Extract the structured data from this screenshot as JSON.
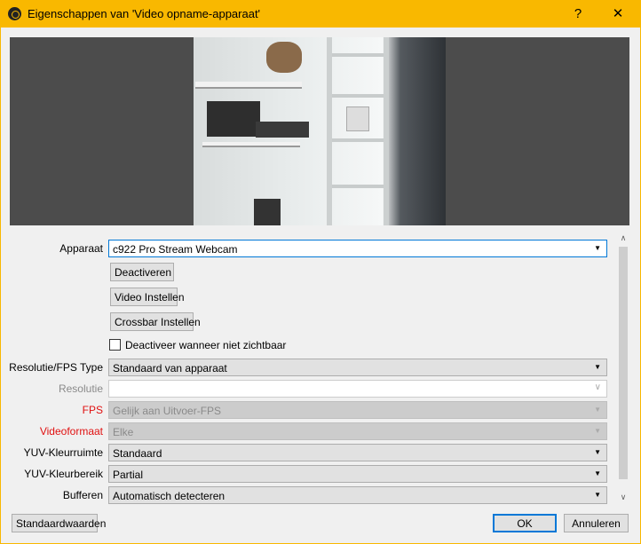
{
  "window": {
    "title": "Eigenschappen van 'Video opname-apparaat'",
    "help": "?",
    "close": "✕"
  },
  "form": {
    "device": {
      "label": "Apparaat",
      "value": "c922 Pro Stream Webcam"
    },
    "deactivate_button": "Deactiveren",
    "video_settings_button": "Video Instellen",
    "crossbar_button": "Crossbar Instellen",
    "deactivate_invisible": {
      "label": "Deactiveer wanneer niet zichtbaar",
      "checked": false
    },
    "res_fps_type": {
      "label": "Resolutie/FPS Type",
      "value": "Standaard van apparaat"
    },
    "resolution": {
      "label": "Resolutie",
      "value": ""
    },
    "fps": {
      "label": "FPS",
      "value": "Gelijk aan Uitvoer-FPS"
    },
    "video_format": {
      "label": "Videoformaat",
      "value": "Elke"
    },
    "yuv_colorspace": {
      "label": "YUV-Kleurruimte",
      "value": "Standaard"
    },
    "yuv_range": {
      "label": "YUV-Kleurbereik",
      "value": "Partial"
    },
    "buffering": {
      "label": "Bufferen",
      "value": "Automatisch detecteren"
    }
  },
  "footer": {
    "defaults": "Standaardwaarden",
    "ok": "OK",
    "cancel": "Annuleren"
  },
  "colors": {
    "accent": "#f9b800",
    "error_label": "#e01010",
    "focus": "#0078d7"
  }
}
